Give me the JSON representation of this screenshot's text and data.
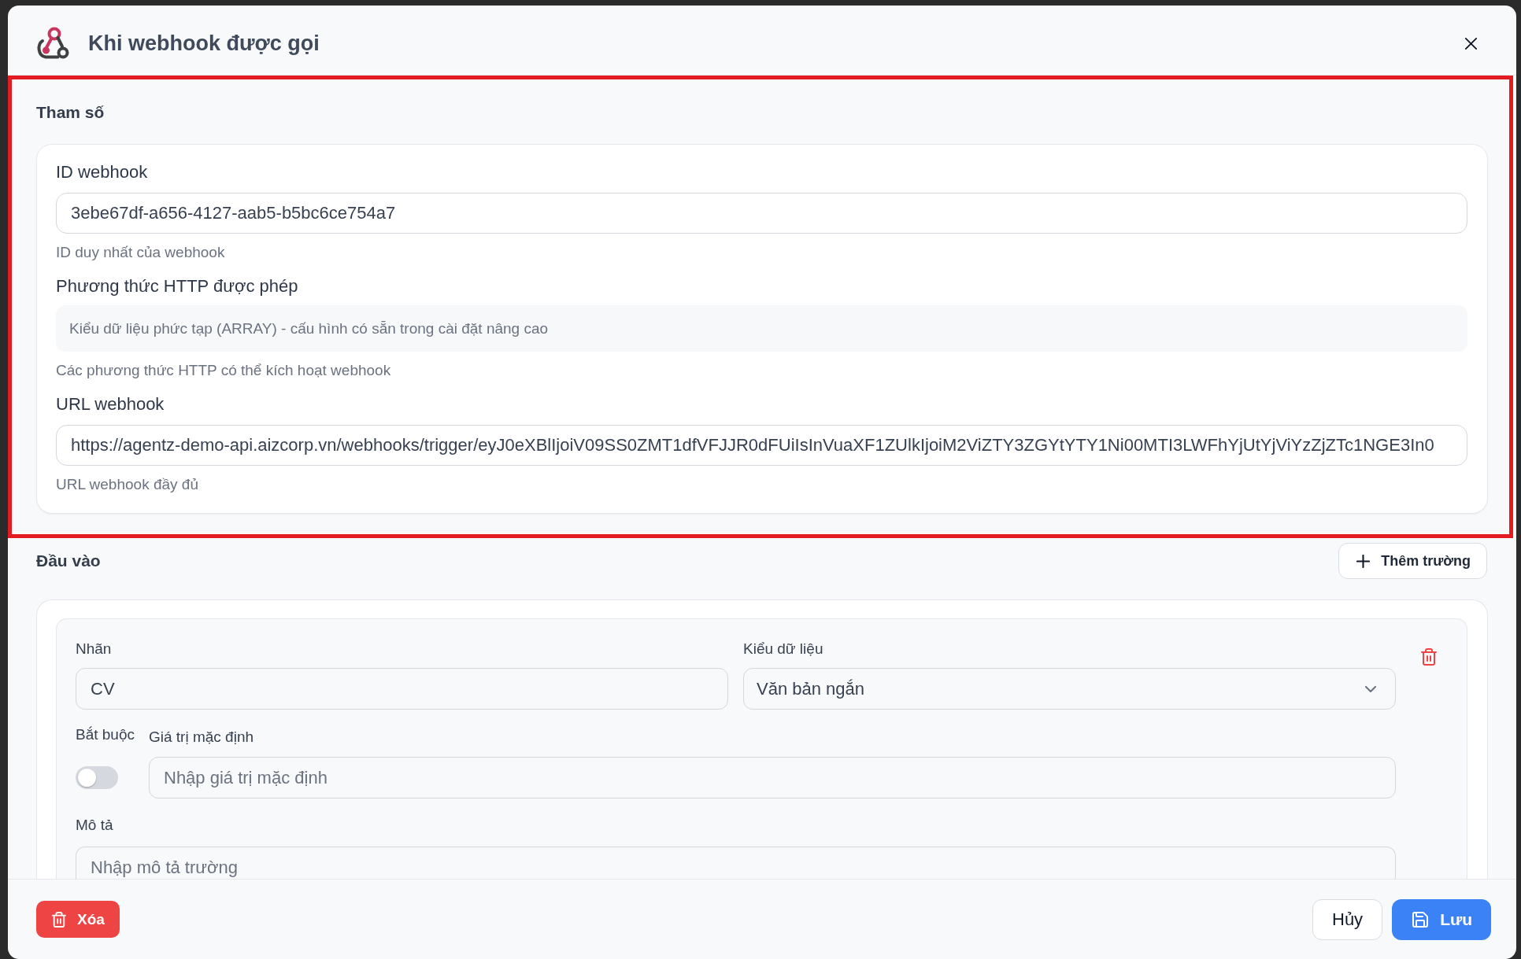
{
  "dialog": {
    "title": "Khi webhook được gọi"
  },
  "parameters": {
    "title": "Tham số",
    "highlighted": true,
    "fields": [
      {
        "kind": "text",
        "label": "ID webhook",
        "value": "3ebe67df-a656-4127-aab5-b5bc6ce754a7",
        "hint": "ID duy nhất của webhook"
      },
      {
        "kind": "note",
        "label": "Phương thức HTTP được phép",
        "note": "Kiểu dữ liệu phức tạp (ARRAY) - cấu hình có sẵn trong cài đặt nâng cao",
        "hint": "Các phương thức HTTP có thể kích hoạt webhook"
      },
      {
        "kind": "text",
        "label": "URL webhook",
        "value": "https://agentz-demo-api.aizcorp.vn/webhooks/trigger/eyJ0eXBlIjoiV09SS0ZMT1dfVFJJR0dFUiIsInVuaXF1ZUlkIjoiM2ViZTY3ZGYtYTY1Ni00MTI3LWFhYjUtYjViYzZjZTc1NGE3In0",
        "hint": "URL webhook đầy đủ"
      }
    ]
  },
  "inputs": {
    "title": "Đầu vào",
    "add_button": "Thêm trường",
    "items": [
      {
        "label_field": {
          "label": "Nhãn",
          "value": "CV"
        },
        "data_type": {
          "label": "Kiểu dữ liệu",
          "value": "Văn bản ngắn"
        },
        "required": {
          "label": "Bắt buộc",
          "on": false
        },
        "default_value": {
          "label": "Giá trị mặc định",
          "placeholder": "Nhập giá trị mặc định"
        },
        "description": {
          "label": "Mô tả",
          "placeholder": "Nhập mô tả trường"
        }
      }
    ]
  },
  "footer": {
    "buttons": [
      {
        "kind": "danger",
        "label": "Xóa"
      },
      {
        "kind": "secondary",
        "label": "Hủy"
      },
      {
        "kind": "primary",
        "label": "Lưu"
      }
    ]
  }
}
